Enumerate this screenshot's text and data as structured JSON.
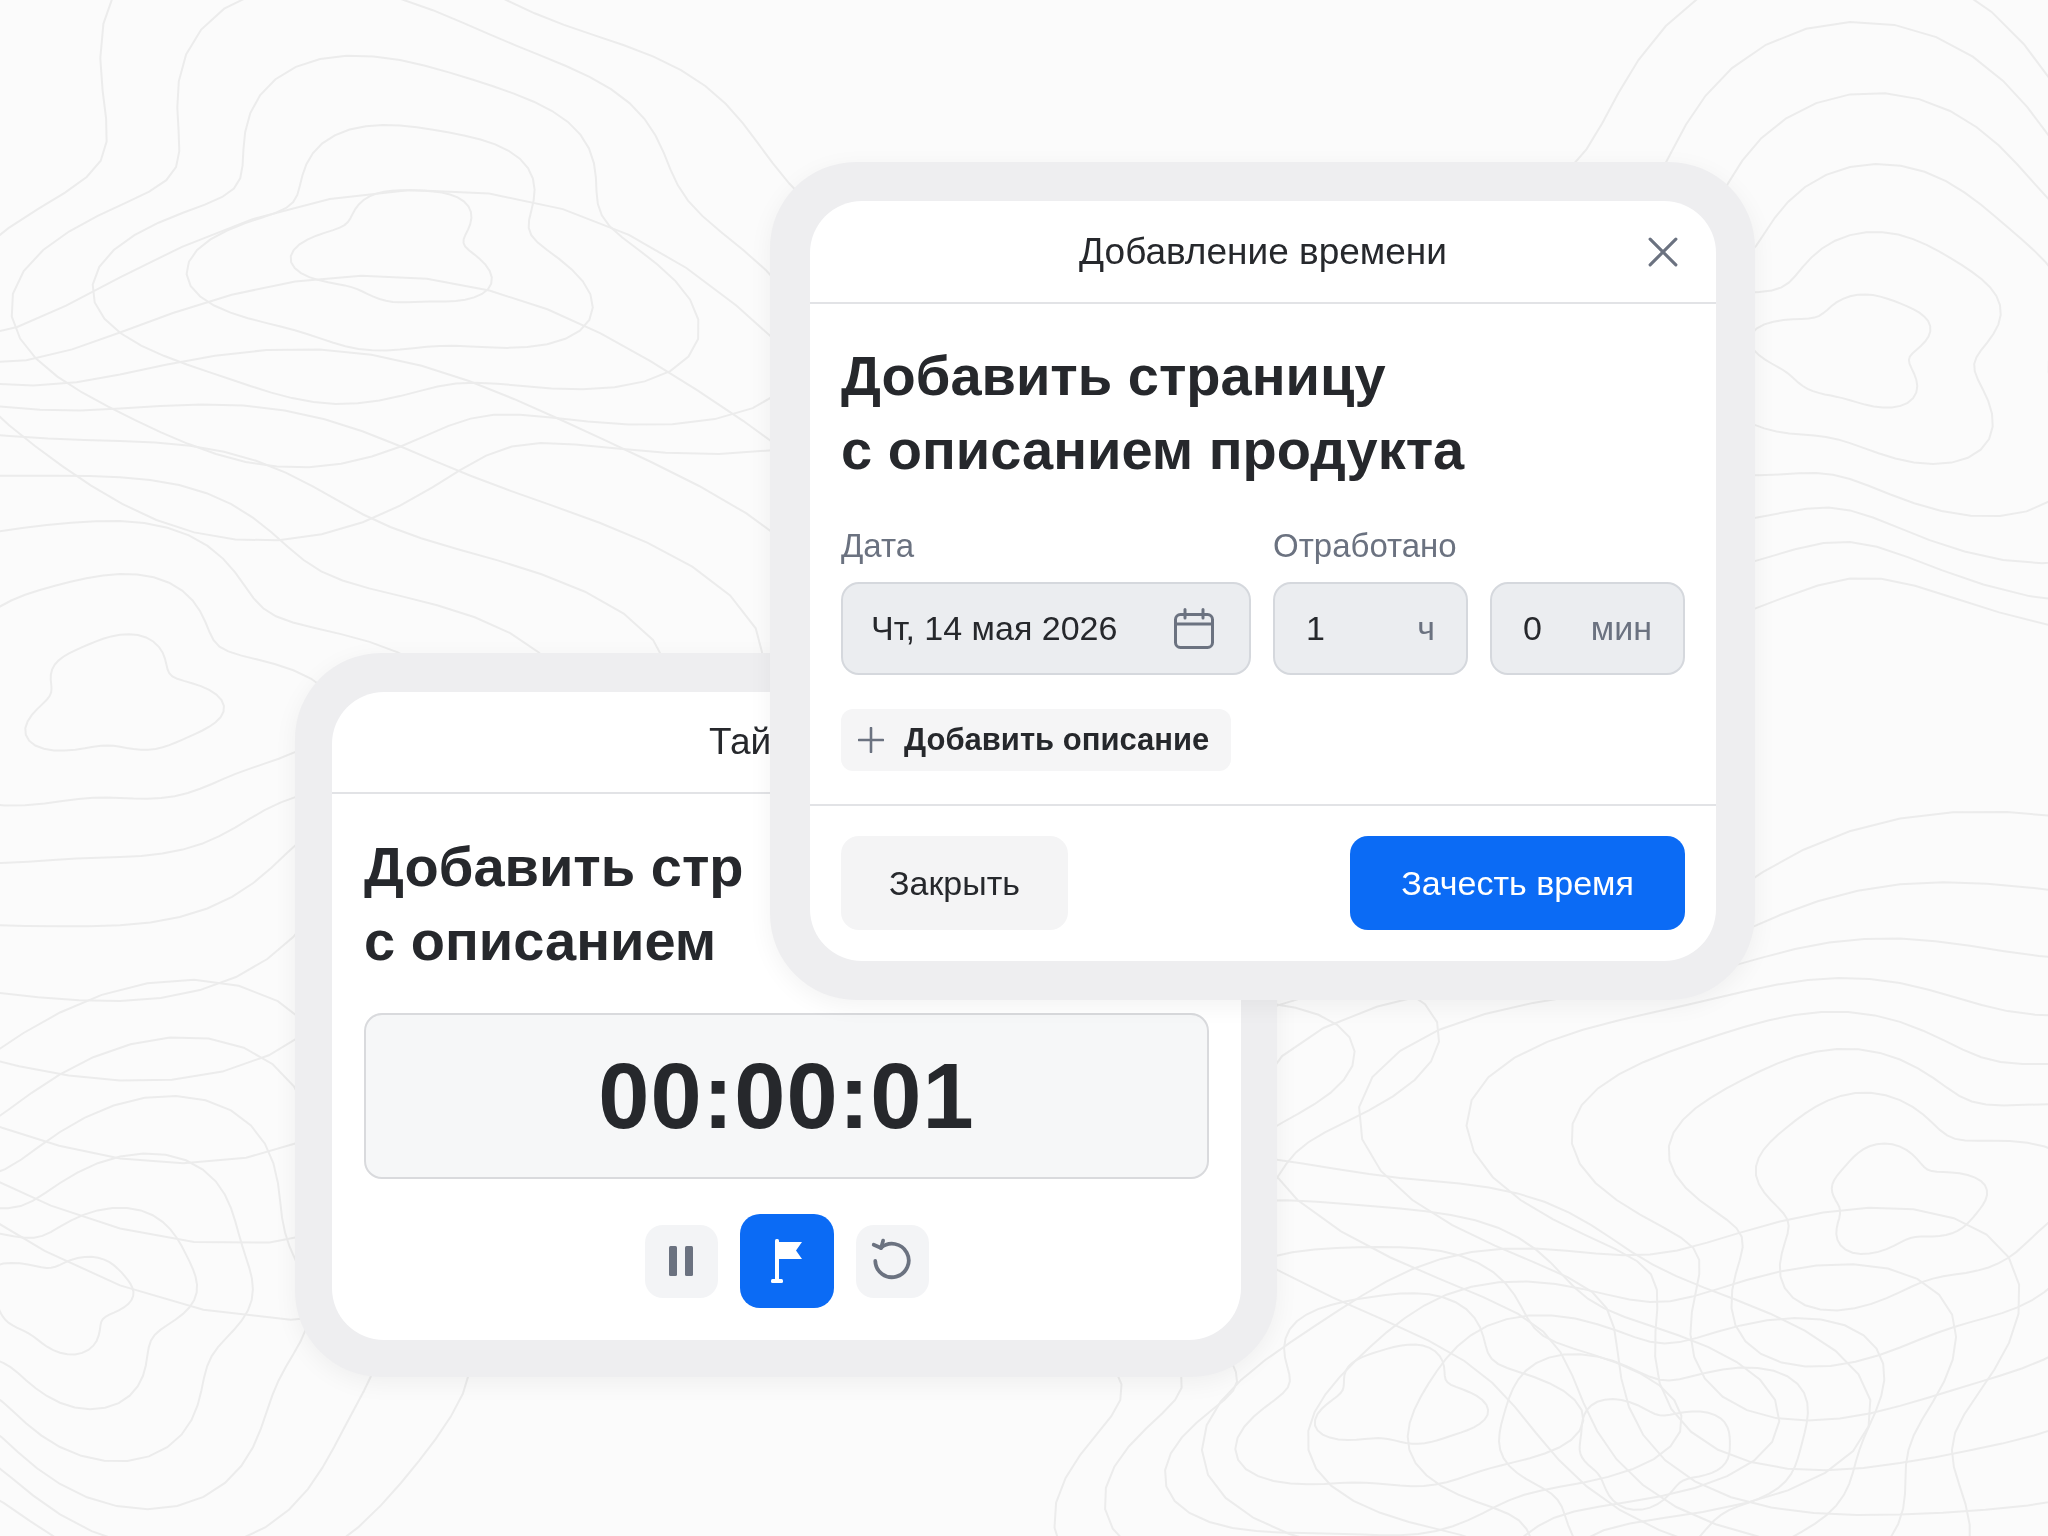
{
  "timer_card": {
    "title": "Тай",
    "task_title": "Добавить стр\nс описанием",
    "elapsed": "00:00:01",
    "controls": [
      {
        "kind": "pause",
        "active": false
      },
      {
        "kind": "flag",
        "active": true
      },
      {
        "kind": "reset",
        "active": false
      }
    ]
  },
  "dialog": {
    "title": "Добавление времени",
    "task_title": "Добавить страницу\nс описанием продукта",
    "date": {
      "label": "Дата",
      "value": "Чт, 14 мая 2026"
    },
    "worked": {
      "label": "Отработано",
      "hours": {
        "value": "1",
        "unit": "ч"
      },
      "minutes": {
        "value": "0",
        "unit": "мин"
      }
    },
    "add_description": "Добавить описание",
    "buttons": [
      {
        "label": "Закрыть",
        "kind": "secondary"
      },
      {
        "label": "Зачесть время",
        "kind": "primary"
      }
    ]
  }
}
